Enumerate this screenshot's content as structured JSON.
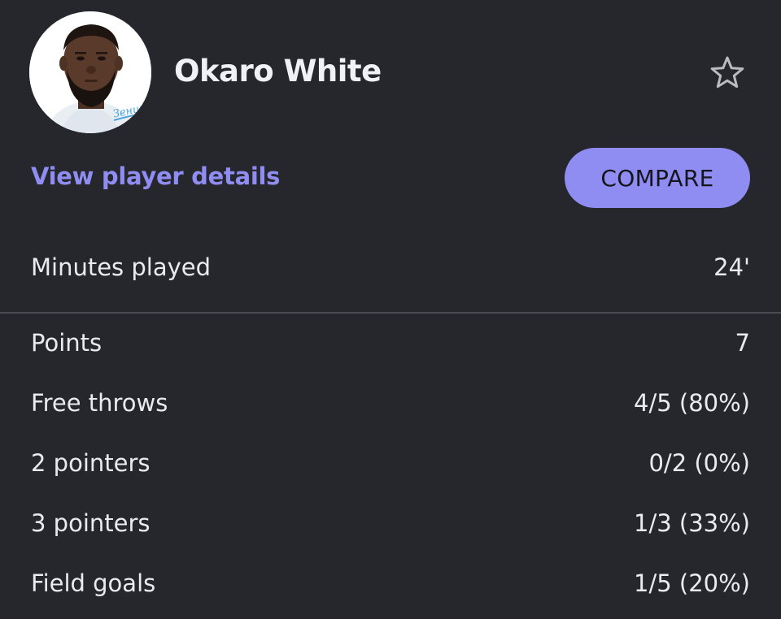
{
  "player": {
    "name": "Okaro White",
    "avatar_badge_text": "Зенит"
  },
  "icons": {
    "favorite": "star-outline-icon"
  },
  "actions": {
    "details_link": "View player details",
    "compare_label": "COMPARE"
  },
  "colors": {
    "background": "#26272c",
    "accent": "#8f8cf2",
    "text": "#eaebee",
    "divider": "#4a4b52"
  },
  "stats": {
    "minutes": {
      "label": "Minutes played",
      "value": "24'"
    },
    "rows": [
      {
        "label": "Points",
        "value": "7"
      },
      {
        "label": "Free throws",
        "value": "4/5 (80%)"
      },
      {
        "label": "2 pointers",
        "value": "0/2 (0%)"
      },
      {
        "label": "3 pointers",
        "value": "1/3 (33%)"
      },
      {
        "label": "Field goals",
        "value": "1/5 (20%)"
      }
    ]
  }
}
